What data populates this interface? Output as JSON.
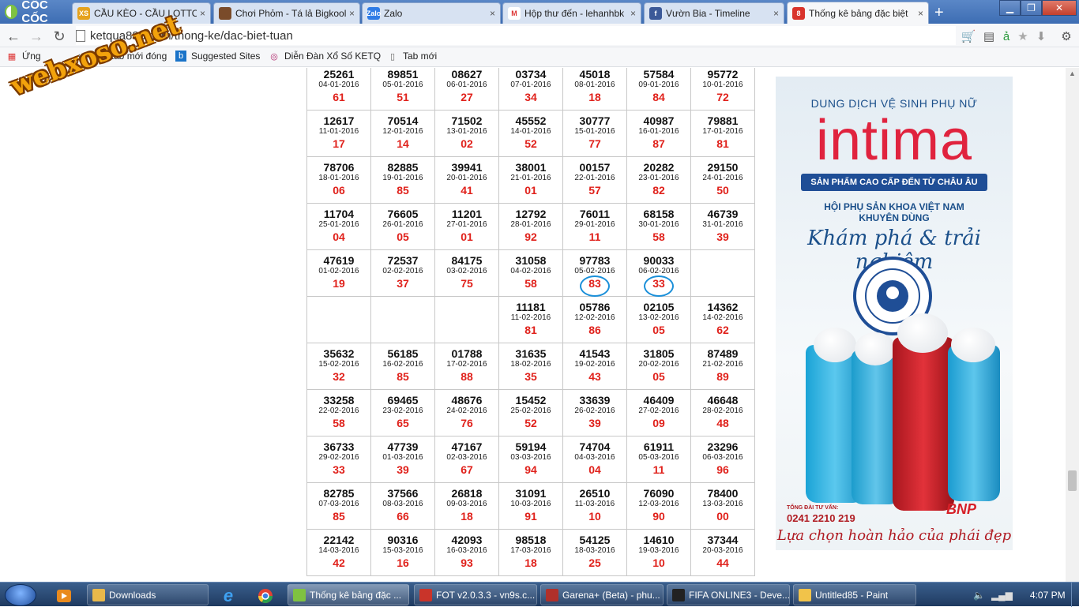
{
  "browser": {
    "brand": "CỐC CỐC",
    "tabs": [
      {
        "label": "CẦU KÈO - CẦU LOTTO, F",
        "fav": "XS",
        "color": "#e5a21d"
      },
      {
        "label": "Chơi Phỏm - Tá lả Bigkool",
        "fav": "",
        "color": "#7a4b2a"
      },
      {
        "label": "Zalo",
        "fav": "Zalo",
        "color": "#2f7ce6"
      },
      {
        "label": "Hộp thư đến - lehanhbk",
        "fav": "M",
        "color": "#ffffff"
      },
      {
        "label": "Vườn Bia - Timeline",
        "fav": "f",
        "color": "#3b5998"
      },
      {
        "label": "Thống kê bảng đặc biệt",
        "fav": "8",
        "color": "#d9332b"
      }
    ],
    "url": "ketqua888.com/thong-ke/dac-biet-tuan",
    "bookmarks": [
      "Ứng",
      "Các tab mới đóng",
      "Suggested Sites",
      "Diễn Đàn Xổ Số KETQ",
      "Tab mới"
    ]
  },
  "watermark": "webxoso.net",
  "results": [
    [
      {
        "n": "25261",
        "d": "04-01-2016",
        "t": "61"
      },
      {
        "n": "89851",
        "d": "05-01-2016",
        "t": "51"
      },
      {
        "n": "08627",
        "d": "06-01-2016",
        "t": "27"
      },
      {
        "n": "03734",
        "d": "07-01-2016",
        "t": "34"
      },
      {
        "n": "45018",
        "d": "08-01-2016",
        "t": "18"
      },
      {
        "n": "57584",
        "d": "09-01-2016",
        "t": "84"
      },
      {
        "n": "95772",
        "d": "10-01-2016",
        "t": "72"
      }
    ],
    [
      {
        "n": "12617",
        "d": "11-01-2016",
        "t": "17"
      },
      {
        "n": "70514",
        "d": "12-01-2016",
        "t": "14"
      },
      {
        "n": "71502",
        "d": "13-01-2016",
        "t": "02"
      },
      {
        "n": "45552",
        "d": "14-01-2016",
        "t": "52"
      },
      {
        "n": "30777",
        "d": "15-01-2016",
        "t": "77"
      },
      {
        "n": "40987",
        "d": "16-01-2016",
        "t": "87"
      },
      {
        "n": "79881",
        "d": "17-01-2016",
        "t": "81"
      }
    ],
    [
      {
        "n": "78706",
        "d": "18-01-2016",
        "t": "06"
      },
      {
        "n": "82885",
        "d": "19-01-2016",
        "t": "85"
      },
      {
        "n": "39941",
        "d": "20-01-2016",
        "t": "41"
      },
      {
        "n": "38001",
        "d": "21-01-2016",
        "t": "01"
      },
      {
        "n": "00157",
        "d": "22-01-2016",
        "t": "57"
      },
      {
        "n": "20282",
        "d": "23-01-2016",
        "t": "82"
      },
      {
        "n": "29150",
        "d": "24-01-2016",
        "t": "50"
      }
    ],
    [
      {
        "n": "11704",
        "d": "25-01-2016",
        "t": "04"
      },
      {
        "n": "76605",
        "d": "26-01-2016",
        "t": "05"
      },
      {
        "n": "11201",
        "d": "27-01-2016",
        "t": "01"
      },
      {
        "n": "12792",
        "d": "28-01-2016",
        "t": "92"
      },
      {
        "n": "76011",
        "d": "29-01-2016",
        "t": "11"
      },
      {
        "n": "68158",
        "d": "30-01-2016",
        "t": "58"
      },
      {
        "n": "46739",
        "d": "31-01-2016",
        "t": "39"
      }
    ],
    [
      {
        "n": "47619",
        "d": "01-02-2016",
        "t": "19"
      },
      {
        "n": "72537",
        "d": "02-02-2016",
        "t": "37"
      },
      {
        "n": "84175",
        "d": "03-02-2016",
        "t": "75"
      },
      {
        "n": "31058",
        "d": "04-02-2016",
        "t": "58"
      },
      {
        "n": "97783",
        "d": "05-02-2016",
        "t": "83",
        "mark": true
      },
      {
        "n": "90033",
        "d": "06-02-2016",
        "t": "33",
        "mark": true
      },
      null
    ],
    [
      null,
      null,
      null,
      {
        "n": "11181",
        "d": "11-02-2016",
        "t": "81"
      },
      {
        "n": "05786",
        "d": "12-02-2016",
        "t": "86"
      },
      {
        "n": "02105",
        "d": "13-02-2016",
        "t": "05"
      },
      {
        "n": "14362",
        "d": "14-02-2016",
        "t": "62"
      }
    ],
    [
      {
        "n": "35632",
        "d": "15-02-2016",
        "t": "32"
      },
      {
        "n": "56185",
        "d": "16-02-2016",
        "t": "85"
      },
      {
        "n": "01788",
        "d": "17-02-2016",
        "t": "88"
      },
      {
        "n": "31635",
        "d": "18-02-2016",
        "t": "35"
      },
      {
        "n": "41543",
        "d": "19-02-2016",
        "t": "43"
      },
      {
        "n": "31805",
        "d": "20-02-2016",
        "t": "05"
      },
      {
        "n": "87489",
        "d": "21-02-2016",
        "t": "89"
      }
    ],
    [
      {
        "n": "33258",
        "d": "22-02-2016",
        "t": "58"
      },
      {
        "n": "69465",
        "d": "23-02-2016",
        "t": "65"
      },
      {
        "n": "48676",
        "d": "24-02-2016",
        "t": "76"
      },
      {
        "n": "15452",
        "d": "25-02-2016",
        "t": "52"
      },
      {
        "n": "33639",
        "d": "26-02-2016",
        "t": "39"
      },
      {
        "n": "46409",
        "d": "27-02-2016",
        "t": "09"
      },
      {
        "n": "46648",
        "d": "28-02-2016",
        "t": "48"
      }
    ],
    [
      {
        "n": "36733",
        "d": "29-02-2016",
        "t": "33"
      },
      {
        "n": "47739",
        "d": "01-03-2016",
        "t": "39"
      },
      {
        "n": "47167",
        "d": "02-03-2016",
        "t": "67"
      },
      {
        "n": "59194",
        "d": "03-03-2016",
        "t": "94"
      },
      {
        "n": "74704",
        "d": "04-03-2016",
        "t": "04"
      },
      {
        "n": "61911",
        "d": "05-03-2016",
        "t": "11"
      },
      {
        "n": "23296",
        "d": "06-03-2016",
        "t": "96"
      }
    ],
    [
      {
        "n": "82785",
        "d": "07-03-2016",
        "t": "85"
      },
      {
        "n": "37566",
        "d": "08-03-2016",
        "t": "66"
      },
      {
        "n": "26818",
        "d": "09-03-2016",
        "t": "18"
      },
      {
        "n": "31091",
        "d": "10-03-2016",
        "t": "91"
      },
      {
        "n": "26510",
        "d": "11-03-2016",
        "t": "10"
      },
      {
        "n": "76090",
        "d": "12-03-2016",
        "t": "90"
      },
      {
        "n": "78400",
        "d": "13-03-2016",
        "t": "00"
      }
    ],
    [
      {
        "n": "22142",
        "d": "14-03-2016",
        "t": "42"
      },
      {
        "n": "90316",
        "d": "15-03-2016",
        "t": "16"
      },
      {
        "n": "42093",
        "d": "16-03-2016",
        "t": "93"
      },
      {
        "n": "98518",
        "d": "17-03-2016",
        "t": "18"
      },
      {
        "n": "54125",
        "d": "18-03-2016",
        "t": "25"
      },
      {
        "n": "14610",
        "d": "19-03-2016",
        "t": "10"
      },
      {
        "n": "37344",
        "d": "20-03-2016",
        "t": "44"
      }
    ]
  ],
  "ad": {
    "top": "DUNG DỊCH VỆ SINH PHỤ NỮ",
    "brand": "intima",
    "ribbon": "SẢN PHẨM CAO CẤP ĐẾN TỪ CHÂU ÂU",
    "assoc1": "HỘI PHỤ SẢN KHOA VIỆT NAM",
    "assoc2": "KHUYÊN DÙNG",
    "slogan": "Khám phá & trải nghiệm",
    "hotline_label": "TỔNG ĐÀI TƯ VẤN:",
    "hotline": "0241 2210 219",
    "logo": "BNP",
    "tagline": "Lựa chọn hoàn hảo của phái đẹp"
  },
  "taskbar": {
    "items": [
      {
        "label": "Downloads",
        "color": "#e8b84a"
      },
      {
        "label": "Thống kê bảng đặc ...",
        "color": "#7fc241",
        "active": true
      },
      {
        "label": "FOT v2.0.3.3 - vn9s.c...",
        "color": "#c9342a"
      },
      {
        "label": "Garena+ (Beta) - phu...",
        "color": "#b0302a"
      },
      {
        "label": "FIFA ONLINE3 - Deve...",
        "color": "#222222"
      },
      {
        "label": "Untitled85 - Paint",
        "color": "#f1c34a"
      }
    ],
    "clock": "4:07 PM"
  }
}
